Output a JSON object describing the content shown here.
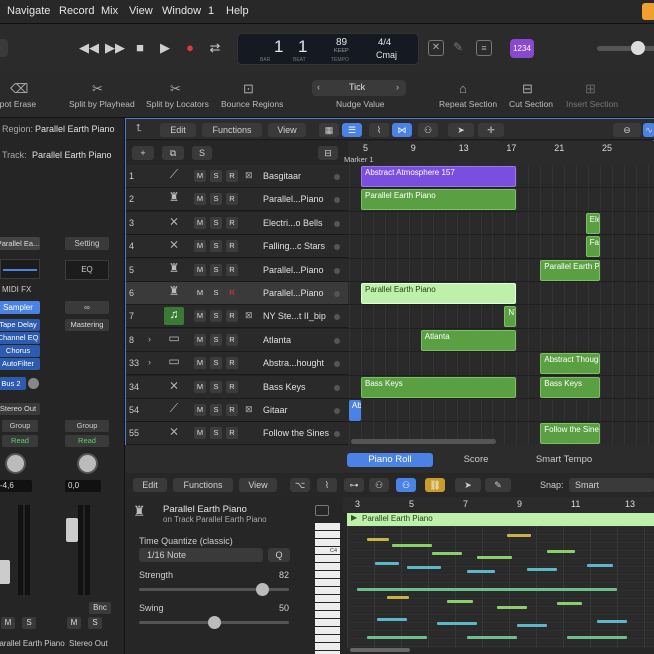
{
  "menubar": {
    "items": [
      "Navigate",
      "Record",
      "Mix",
      "View",
      "Window",
      "1",
      "Help"
    ]
  },
  "lcd": {
    "bar": "1",
    "beat": "1",
    "bar_label": "BAR",
    "beat_label": "BEAT",
    "tempo": "89",
    "keep": "KEEP",
    "tempo_label": "TEMPO",
    "sig": "4/4",
    "key": "Cmaj"
  },
  "count_in": "1234",
  "controlbar": {
    "items": [
      "Spot Erase",
      "Split by Playhead",
      "Split by Locators",
      "Bounce Regions",
      "Nudge Value",
      "Repeat Section",
      "Cut Section",
      "Insert Section"
    ],
    "nudge_value": "Tick"
  },
  "inspector": {
    "region_label": "Region:",
    "region_name": "Parallel Earth Piano",
    "track_label": "Track:",
    "track_name": "Parallel Earth Piano",
    "setting": "Setting",
    "eq": "EQ",
    "plugin_slot": "Parallel Ea...",
    "midi_fx": "MIDI FX",
    "sampler": "Sampler",
    "fx": [
      "Tape Delay",
      "Channel EQ",
      "Chorus",
      "AutoFilter"
    ],
    "mastering": "Mastering",
    "bus": "Bus 2",
    "output_left": "Stereo Out",
    "group": "Group",
    "read": "Read",
    "vol_left": "-4,6",
    "vol_right": "0,0",
    "bnc": "Bnc",
    "m": "M",
    "s": "S",
    "ch_left": "Parallel Earth Piano",
    "ch_right": "Stereo Out"
  },
  "tracks_toolbar": {
    "edit": "Edit",
    "functions": "Functions",
    "view": "View",
    "s": "S"
  },
  "ruler": {
    "marker": "Marker 1",
    "bars": [
      "5",
      "9",
      "13",
      "17",
      "21",
      "25"
    ]
  },
  "tracks": [
    {
      "num": "1",
      "name": "Basgitaar",
      "icon": "guitar-icon"
    },
    {
      "num": "2",
      "name": "Parallel...Piano",
      "icon": "piano-icon"
    },
    {
      "num": "3",
      "name": "Electri...o Bells",
      "icon": "keyboard-icon"
    },
    {
      "num": "4",
      "name": "Falling...c Stars",
      "icon": "keyboard-icon"
    },
    {
      "num": "5",
      "name": "Parallel...Piano",
      "icon": "piano-icon"
    },
    {
      "num": "6",
      "name": "Parallel...Piano",
      "icon": "piano-icon"
    },
    {
      "num": "7",
      "name": "NY Ste...t II_bip",
      "icon": "note-icon"
    },
    {
      "num": "8",
      "name": "Atlanta",
      "icon": "stack-icon"
    },
    {
      "num": "33",
      "name": "Abstra...hought",
      "icon": "stack-icon"
    },
    {
      "num": "34",
      "name": "Bass Keys",
      "icon": "keyboard-icon"
    },
    {
      "num": "54",
      "name": "Gitaar",
      "icon": "guitar-icon"
    },
    {
      "num": "55",
      "name": "Follow the Sines",
      "icon": "keyboard-icon"
    }
  ],
  "track_buttons": {
    "m": "M",
    "s": "S",
    "r": "R"
  },
  "regions": [
    {
      "row": 0,
      "text": "Abstract Atmosphere 157",
      "start": 5.0,
      "end": 18.0,
      "kind": "p"
    },
    {
      "row": 1,
      "text": "Parallel Earth Piano",
      "start": 5.0,
      "end": 18.0,
      "kind": "g"
    },
    {
      "row": 2,
      "text": "Ele",
      "start": 23.8,
      "end": 25.0,
      "kind": "g"
    },
    {
      "row": 3,
      "text": "Fal",
      "start": 23.8,
      "end": 25.0,
      "kind": "g"
    },
    {
      "row": 4,
      "text": "Parallel Earth Pia",
      "start": 20.0,
      "end": 25.0,
      "kind": "g"
    },
    {
      "row": 5,
      "text": "Parallel Earth Piano",
      "start": 5.0,
      "end": 18.0,
      "kind": "gl"
    },
    {
      "row": 6,
      "text": "NY Ste",
      "start": 17.0,
      "end": 18.0,
      "kind": "g"
    },
    {
      "row": 7,
      "text": "Atlanta",
      "start": 10.0,
      "end": 18.0,
      "kind": "g"
    },
    {
      "row": 8,
      "text": "Abstract Thought",
      "start": 20.0,
      "end": 25.0,
      "kind": "g"
    },
    {
      "row": 9,
      "text": "Bass Keys",
      "start": 5.0,
      "end": 18.0,
      "kind": "g"
    },
    {
      "row": 9,
      "text": "Bass Keys",
      "start": 20.0,
      "end": 25.0,
      "kind": "g"
    },
    {
      "row": 10,
      "text": "Ab",
      "start": 4.0,
      "end": 5.0,
      "kind": "b"
    },
    {
      "row": 11,
      "text": "Follow the Sines",
      "start": 20.0,
      "end": 25.0,
      "kind": "g"
    }
  ],
  "editor": {
    "tabs": [
      "Piano Roll",
      "Score",
      "Smart Tempo"
    ],
    "edit": "Edit",
    "functions": "Functions",
    "view": "View",
    "snap_label": "Snap:",
    "snap_value": "Smart",
    "region_name": "Parallel Earth Piano",
    "region_sub": "on Track Parallel Earth Piano",
    "tq_label": "Time Quantize (classic)",
    "tq_value": "1/16 Note",
    "q": "Q",
    "strength_label": "Strength",
    "strength_value": "82",
    "swing_label": "Swing",
    "swing_value": "50",
    "strength": 0.82,
    "swing": 0.5,
    "ruler": [
      "3",
      "5",
      "7",
      "9",
      "11",
      "13"
    ],
    "region_header": "Parallel Earth Piano",
    "octave": "C4"
  },
  "colors": {
    "accent": "#4a82e6",
    "green": "#5aa043",
    "purple": "#7a4fe0"
  }
}
